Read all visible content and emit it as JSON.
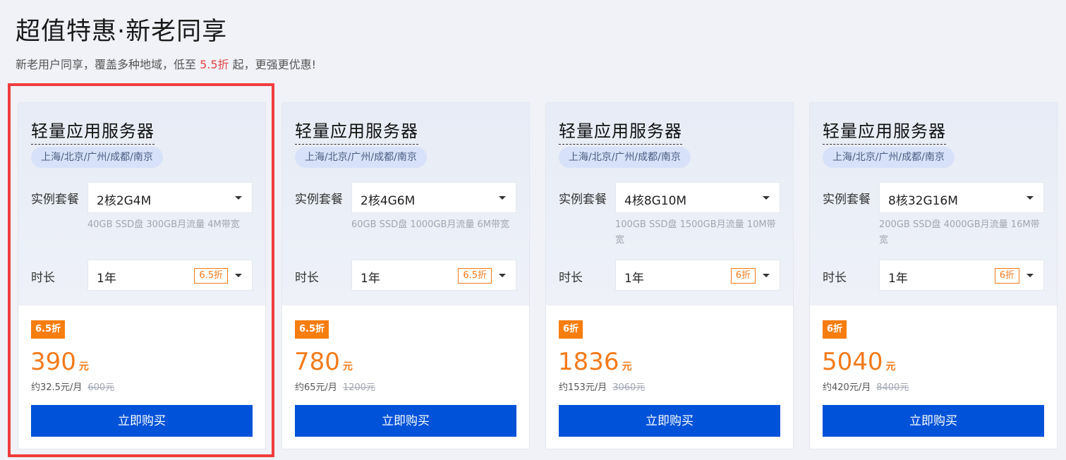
{
  "header": {
    "title": "超值特惠·新老同享",
    "subtitle_pre": "新老用户同享，覆盖多种地域，低至 ",
    "subtitle_highlight": "5.5折",
    "subtitle_post": " 起，更强更优惠!"
  },
  "labels": {
    "package": "实例套餐",
    "duration": "时长",
    "buy": "立即购买"
  },
  "cards": [
    {
      "title": "轻量应用服务器",
      "regions": "上海/北京/广州/成都/南京",
      "package": "2核2G4M",
      "spec": "40GB SSD盘 300GB月流量 4M带宽",
      "duration": "1年",
      "duration_discount": "6.5折",
      "discount_badge": "6.5折",
      "price": "390",
      "price_unit": "元",
      "monthly": "约32.5元/月",
      "original": "600元"
    },
    {
      "title": "轻量应用服务器",
      "regions": "上海/北京/广州/成都/南京",
      "package": "2核4G6M",
      "spec": "60GB SSD盘 1000GB月流量 6M带宽",
      "duration": "1年",
      "duration_discount": "6.5折",
      "discount_badge": "6.5折",
      "price": "780",
      "price_unit": "元",
      "monthly": "约65元/月",
      "original": "1200元"
    },
    {
      "title": "轻量应用服务器",
      "regions": "上海/北京/广州/成都/南京",
      "package": "4核8G10M",
      "spec": "100GB SSD盘 1500GB月流量 10M带宽",
      "duration": "1年",
      "duration_discount": "6折",
      "discount_badge": "6折",
      "price": "1836",
      "price_unit": "元",
      "monthly": "约153元/月",
      "original": "3060元"
    },
    {
      "title": "轻量应用服务器",
      "regions": "上海/北京/广州/成都/南京",
      "package": "8核32G16M",
      "spec": "200GB SSD盘 4000GB月流量 16M带宽",
      "duration": "1年",
      "duration_discount": "6折",
      "discount_badge": "6折",
      "price": "5040",
      "price_unit": "元",
      "monthly": "约420元/月",
      "original": "8400元"
    }
  ],
  "colors": {
    "accent": "#0052d9",
    "discount": "#f47a1a",
    "highlight_border": "#f03c3c"
  }
}
